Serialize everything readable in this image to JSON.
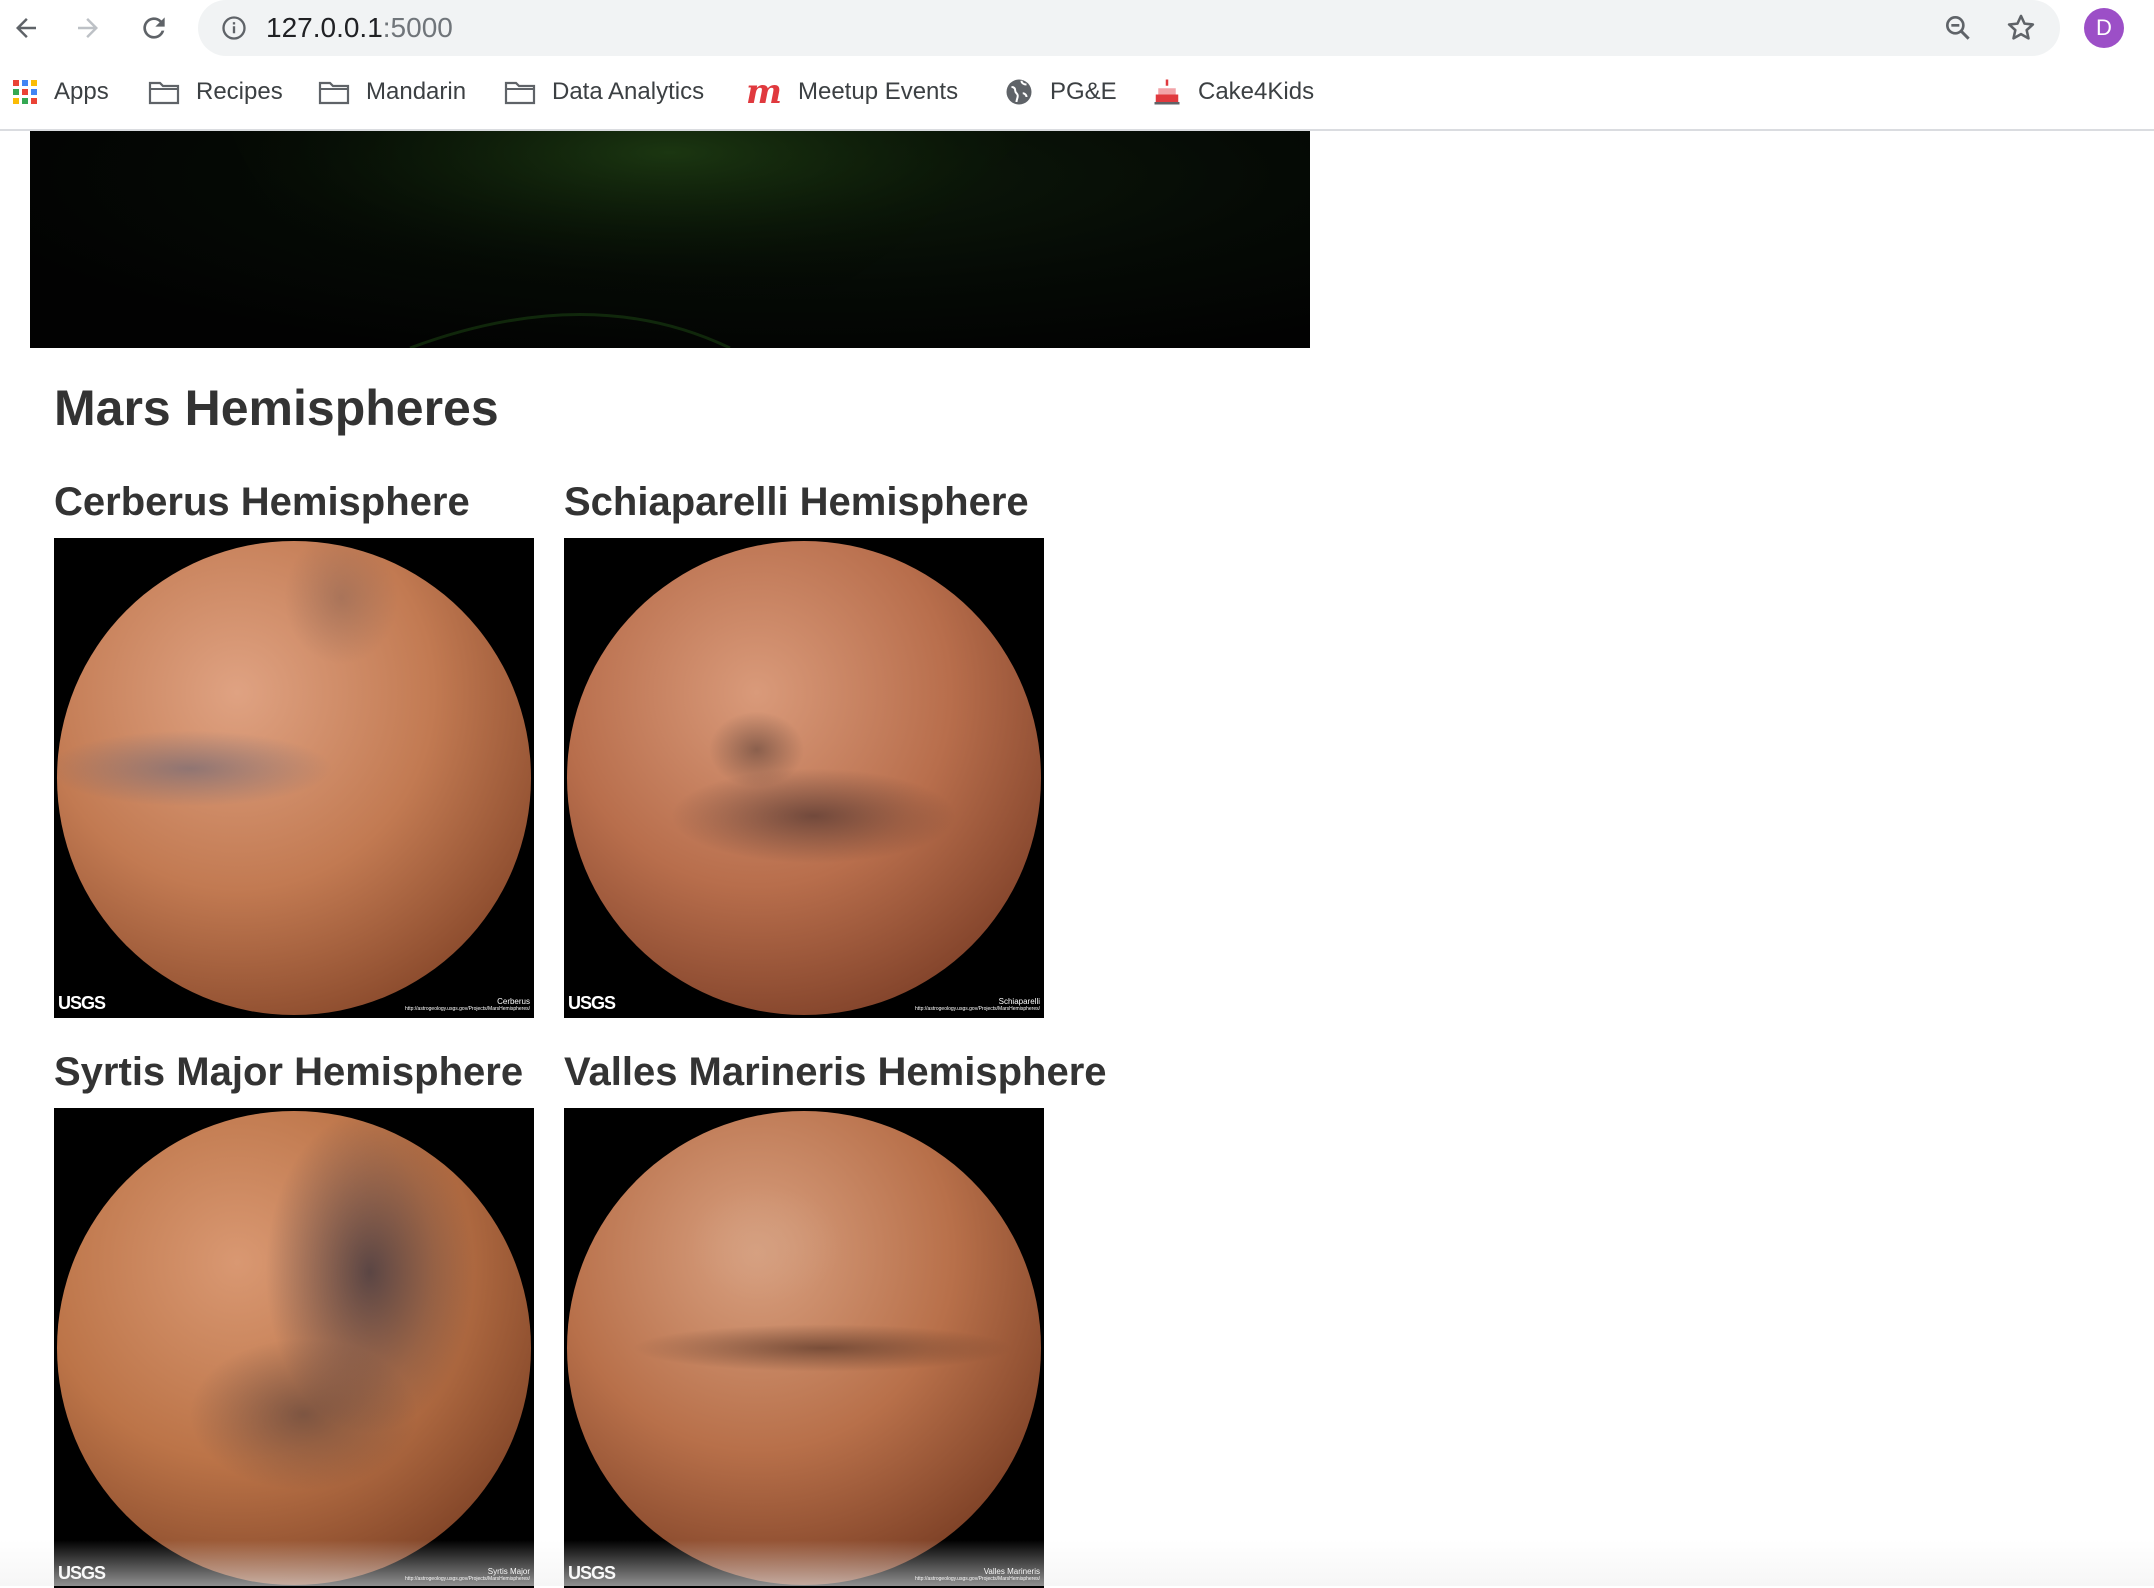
{
  "browser": {
    "url_host": "127.0.0.1",
    "url_port": ":5000",
    "profile_initial": "D",
    "bookmarks": [
      {
        "label": "Apps",
        "icon": "apps-grid-icon"
      },
      {
        "label": "Recipes",
        "icon": "folder-icon"
      },
      {
        "label": "Mandarin",
        "icon": "folder-icon"
      },
      {
        "label": "Data Analytics",
        "icon": "folder-icon"
      },
      {
        "label": "Meetup Events",
        "icon": "meetup-icon"
      },
      {
        "label": "PG&E",
        "icon": "globe-icon"
      },
      {
        "label": "Cake4Kids",
        "icon": "cake-icon"
      }
    ]
  },
  "page": {
    "section_title": "Mars Hemispheres",
    "hemispheres": [
      {
        "title": "Cerberus Hemisphere",
        "caption": "Cerberus",
        "logo": "USGS",
        "credit_url": "http://astrogeology.usgs.gov/Projects/MarsHemispheres/"
      },
      {
        "title": "Schiaparelli Hemisphere",
        "caption": "Schiaparelli",
        "logo": "USGS",
        "credit_url": "http://astrogeology.usgs.gov/Projects/MarsHemispheres/"
      },
      {
        "title": "Syrtis Major Hemisphere",
        "caption": "Syrtis Major",
        "logo": "USGS",
        "credit_url": "http://astrogeology.usgs.gov/Projects/MarsHemispheres/"
      },
      {
        "title": "Valles Marineris Hemisphere",
        "caption": "Valles Marineris",
        "logo": "USGS",
        "credit_url": "http://astrogeology.usgs.gov/Projects/MarsHemispheres/"
      }
    ]
  },
  "colors": {
    "avatar": "#9c4fc7",
    "heading_text": "#333333",
    "mars_base": "#c27a52"
  }
}
